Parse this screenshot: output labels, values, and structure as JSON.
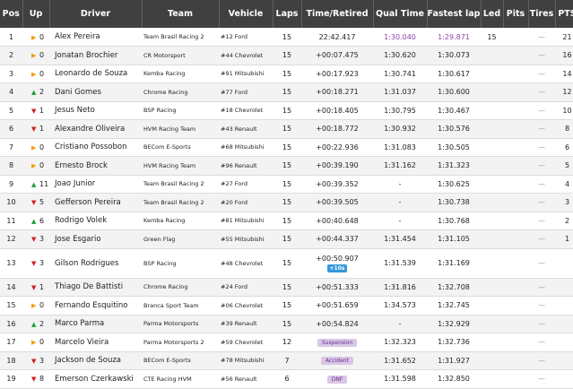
{
  "columns": {
    "pos": "Pos",
    "up": "Up",
    "driver": "Driver",
    "team": "Team",
    "vehicle": "Vehicle",
    "laps": "Laps",
    "time": "Time/Retired",
    "qual": "Qual Time",
    "fastest": "Fastest lap",
    "led": "Led",
    "pits": "Pits",
    "tires": "Tires",
    "pts": "PTS"
  },
  "colors": {
    "header_bg": "#404040",
    "same": "#f39c12",
    "gain": "#1e9e3a",
    "loss": "#cc1f1f",
    "best": "#8e44ad",
    "penalty": "#3498db"
  },
  "rows": [
    {
      "pos": "1",
      "dir": "same",
      "up": "0",
      "driver": "Alex Pereira",
      "team": "Team Brasil Racing 2",
      "vehicle": "#12 Ford",
      "laps": "15",
      "time": "22:42.417",
      "qual": "1:30.040",
      "fast": "1:29.871",
      "led": "15",
      "pits": "",
      "tires": "—",
      "pts": "21"
    },
    {
      "pos": "2",
      "dir": "same",
      "up": "0",
      "driver": "Jonatan Brochier",
      "team": "CR Motorsport",
      "vehicle": "#44 Chevrolet",
      "laps": "15",
      "time": "+00:07.475",
      "qual": "1:30.620",
      "fast": "1:30.073",
      "led": "",
      "pits": "",
      "tires": "—",
      "pts": "16"
    },
    {
      "pos": "3",
      "dir": "same",
      "up": "0",
      "driver": "Leonardo de Souza",
      "team": "Kemba Racing",
      "vehicle": "#91 Mitsubishi",
      "laps": "15",
      "time": "+00:17.923",
      "qual": "1:30.741",
      "fast": "1:30.617",
      "led": "",
      "pits": "",
      "tires": "—",
      "pts": "14"
    },
    {
      "pos": "4",
      "dir": "gain",
      "up": "2",
      "driver": "Dani Gomes",
      "team": "Chrome Racing",
      "vehicle": "#77 Ford",
      "laps": "15",
      "time": "+00:18.271",
      "qual": "1:31.037",
      "fast": "1:30.600",
      "led": "",
      "pits": "",
      "tires": "—",
      "pts": "12"
    },
    {
      "pos": "5",
      "dir": "loss",
      "up": "1",
      "driver": "Jesus Neto",
      "team": "BSP Racing",
      "vehicle": "#18 Chevrolet",
      "laps": "15",
      "time": "+00:18.405",
      "qual": "1:30.795",
      "fast": "1:30.467",
      "led": "",
      "pits": "",
      "tires": "—",
      "pts": "10"
    },
    {
      "pos": "6",
      "dir": "loss",
      "up": "1",
      "driver": "Alexandre Oliveira",
      "team": "HVM Racing Team",
      "vehicle": "#43 Renault",
      "laps": "15",
      "time": "+00:18.772",
      "qual": "1:30.932",
      "fast": "1:30.576",
      "led": "",
      "pits": "",
      "tires": "—",
      "pts": "8"
    },
    {
      "pos": "7",
      "dir": "same",
      "up": "0",
      "driver": "Cristiano Possobon",
      "team": "BECom E-Sports",
      "vehicle": "#68 Mitsubishi",
      "laps": "15",
      "time": "+00:22.936",
      "qual": "1:31.083",
      "fast": "1:30.505",
      "led": "",
      "pits": "",
      "tires": "—",
      "pts": "6"
    },
    {
      "pos": "8",
      "dir": "same",
      "up": "0",
      "driver": "Ernesto Brock",
      "team": "HVM Racing Team",
      "vehicle": "#96 Renault",
      "laps": "15",
      "time": "+00:39.190",
      "qual": "1:31.162",
      "fast": "1:31.323",
      "led": "",
      "pits": "",
      "tires": "—",
      "pts": "5"
    },
    {
      "pos": "9",
      "dir": "gain",
      "up": "11",
      "driver": "Joao Junior",
      "team": "Team Brasil Racing 2",
      "vehicle": "#27 Ford",
      "laps": "15",
      "time": "+00:39.352",
      "qual": "-",
      "fast": "1:30.625",
      "led": "",
      "pits": "",
      "tires": "—",
      "pts": "4"
    },
    {
      "pos": "10",
      "dir": "loss",
      "up": "5",
      "driver": "Gefferson Pereira",
      "team": "Team Brasil Racing 2",
      "vehicle": "#20 Ford",
      "laps": "15",
      "time": "+00:39.505",
      "qual": "-",
      "fast": "1:30.738",
      "led": "",
      "pits": "",
      "tires": "—",
      "pts": "3"
    },
    {
      "pos": "11",
      "dir": "gain",
      "up": "6",
      "driver": "Rodrigo Volek",
      "team": "Kemba Racing",
      "vehicle": "#81 Mitsubishi",
      "laps": "15",
      "time": "+00:40.648",
      "qual": "-",
      "fast": "1:30.768",
      "led": "",
      "pits": "",
      "tires": "—",
      "pts": "2"
    },
    {
      "pos": "12",
      "dir": "loss",
      "up": "3",
      "driver": "Jose Esgario",
      "team": "Green Flag",
      "vehicle": "#55 Mitsubishi",
      "laps": "15",
      "time": "+00:44.337",
      "qual": "1:31.454",
      "fast": "1:31.105",
      "led": "",
      "pits": "",
      "tires": "—",
      "pts": "1"
    },
    {
      "pos": "13",
      "dir": "loss",
      "up": "3",
      "driver": "Gilson Rodrigues",
      "team": "BSP Racing",
      "vehicle": "#48 Chevrolet",
      "laps": "15",
      "time": "+00:50.907",
      "penalty": "+10s",
      "qual": "1:31.539",
      "fast": "1:31.169",
      "led": "",
      "pits": "",
      "tires": "—",
      "pts": ""
    },
    {
      "pos": "14",
      "dir": "loss",
      "up": "1",
      "driver": "Thiago De Battisti",
      "team": "Chrome Racing",
      "vehicle": "#24 Ford",
      "laps": "15",
      "time": "+00:51.333",
      "qual": "1:31.816",
      "fast": "1:32.708",
      "led": "",
      "pits": "",
      "tires": "—",
      "pts": ""
    },
    {
      "pos": "15",
      "dir": "same",
      "up": "0",
      "driver": "Fernando Esquitino",
      "team": "Branca Sport Team",
      "vehicle": "#06 Chevrolet",
      "laps": "15",
      "time": "+00:51.659",
      "qual": "1:34.573",
      "fast": "1:32.745",
      "led": "",
      "pits": "",
      "tires": "—",
      "pts": ""
    },
    {
      "pos": "16",
      "dir": "gain",
      "up": "2",
      "driver": "Marco Parma",
      "team": "Parma Motorsports",
      "vehicle": "#39 Renault",
      "laps": "15",
      "time": "+00:54.824",
      "qual": "-",
      "fast": "1:32.929",
      "led": "",
      "pits": "",
      "tires": "—",
      "pts": ""
    },
    {
      "pos": "17",
      "dir": "same",
      "up": "0",
      "driver": "Marcelo Vieira",
      "team": "Parma Motorsports 2",
      "vehicle": "#59 Chevrolet",
      "laps": "12",
      "status": "Suspension",
      "qual": "1:32.323",
      "fast": "1:32.736",
      "led": "",
      "pits": "",
      "tires": "—",
      "pts": ""
    },
    {
      "pos": "18",
      "dir": "loss",
      "up": "3",
      "driver": "Jackson de Souza",
      "team": "BECom E-Sports",
      "vehicle": "#78 Mitsubishi",
      "laps": "7",
      "status": "Accident",
      "qual": "1:31.652",
      "fast": "1:31.927",
      "led": "",
      "pits": "",
      "tires": "—",
      "pts": ""
    },
    {
      "pos": "19",
      "dir": "loss",
      "up": "8",
      "driver": "Emerson Czerkawski",
      "team": "CTE Racing HVM",
      "vehicle": "#56 Renault",
      "laps": "6",
      "status": "DNF",
      "qual": "1:31.598",
      "fast": "1:32.850",
      "led": "",
      "pits": "",
      "tires": "—",
      "pts": ""
    }
  ]
}
